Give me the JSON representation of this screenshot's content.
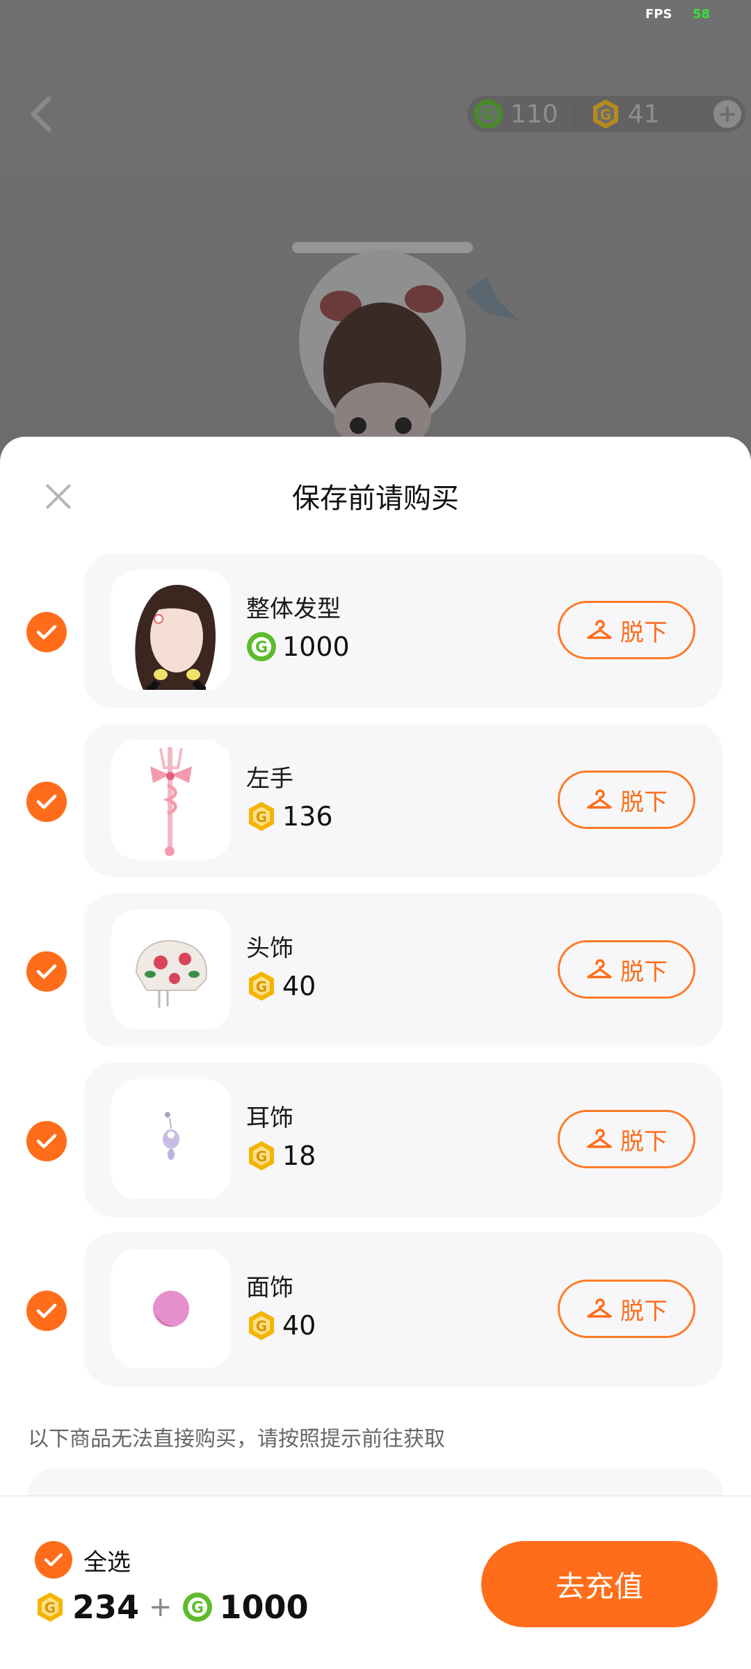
{
  "status": {
    "fps_label": "FPS",
    "fps_value": "58"
  },
  "top_bar": {
    "green_currency": "110",
    "gold_currency": "41",
    "add_symbol": "+"
  },
  "sheet": {
    "title": "保存前请购买",
    "takeoff_label": "脱下",
    "items": [
      {
        "name": "整体发型",
        "currency": "green",
        "price": "1000"
      },
      {
        "name": "左手",
        "currency": "gold",
        "price": "136"
      },
      {
        "name": "头饰",
        "currency": "gold",
        "price": "40"
      },
      {
        "name": "耳饰",
        "currency": "gold",
        "price": "18"
      },
      {
        "name": "面饰",
        "currency": "gold",
        "price": "40"
      }
    ],
    "note": "以下商品无法直接购买，请按照提示前往获取"
  },
  "footer": {
    "select_all": "全选",
    "gold_total": "234",
    "plus": "+",
    "green_total": "1000",
    "recharge_button": "去充值"
  },
  "colors": {
    "accent": "#ff6d1a",
    "green_coin": "#5dbb2c",
    "gold_coin": "#f5b400"
  }
}
